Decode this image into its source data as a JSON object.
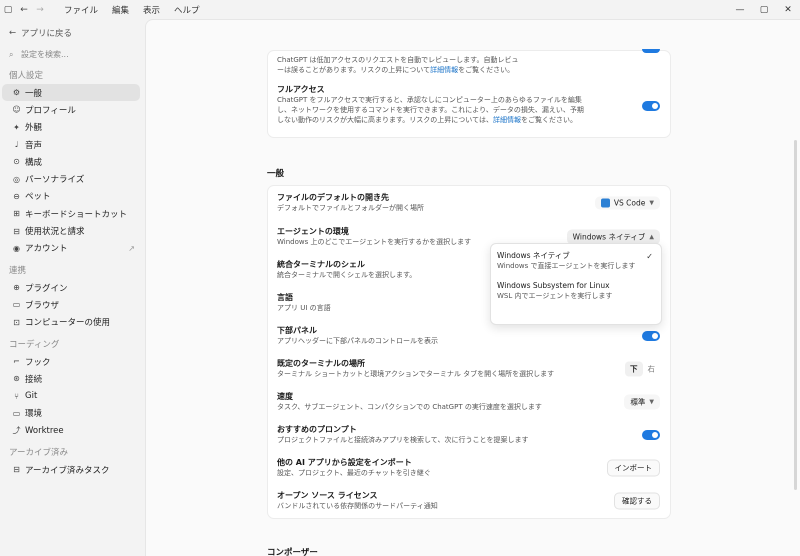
{
  "titlebar": {
    "menu": [
      "ファイル",
      "編集",
      "表示",
      "ヘルプ"
    ]
  },
  "sidebar": {
    "back_label": "アプリに戻る",
    "search_placeholder": "設定を検索...",
    "sections": [
      {
        "label": "個人設定",
        "items": [
          {
            "label": "一般",
            "icon": "gear-icon",
            "active": true
          },
          {
            "label": "プロフィール",
            "icon": "profile-icon"
          },
          {
            "label": "外観",
            "icon": "appearance-icon"
          },
          {
            "label": "音声",
            "icon": "microphone-icon"
          },
          {
            "label": "構成",
            "icon": "config-icon"
          },
          {
            "label": "パーソナライズ",
            "icon": "personalize-icon"
          },
          {
            "label": "ペット",
            "icon": "pet-icon"
          },
          {
            "label": "キーボードショートカット",
            "icon": "keyboard-icon"
          },
          {
            "label": "使用状況と請求",
            "icon": "usage-icon"
          },
          {
            "label": "アカウント",
            "icon": "account-icon",
            "external": true
          }
        ]
      },
      {
        "label": "連携",
        "items": [
          {
            "label": "プラグイン",
            "icon": "plugin-icon"
          },
          {
            "label": "ブラウザ",
            "icon": "browser-icon"
          },
          {
            "label": "コンピューターの使用",
            "icon": "computer-use-icon"
          }
        ]
      },
      {
        "label": "コーディング",
        "items": [
          {
            "label": "フック",
            "icon": "hook-icon"
          },
          {
            "label": "接続",
            "icon": "connection-icon"
          },
          {
            "label": "Git",
            "icon": "git-icon"
          },
          {
            "label": "環境",
            "icon": "environment-icon"
          },
          {
            "label": "Worktree",
            "icon": "worktree-icon"
          }
        ]
      },
      {
        "label": "アーカイブ済み",
        "items": [
          {
            "label": "アーカイブ済みタスク",
            "icon": "archive-icon"
          }
        ]
      }
    ]
  },
  "top_card": {
    "partial_line1": "ChatGPT は低加アクセスのリクエストを自動でレビューします。自動レビュ",
    "partial_line2": "ーは誤ることがあります。リスクの上昇について",
    "partial_link": "詳細情報",
    "partial_end": "をご覧ください。",
    "full_access_title": "フルアクセス",
    "full_access_desc1": "ChatGPT をフルアクセスで実行すると、承認なしにコンピューター上のあらゆるファイルを編集",
    "full_access_desc2": "し、ネットワークを使用するコマンドを実行できます。これにより、データの損失、漏えい、予期",
    "full_access_desc3": "しない動作のリスクが大幅に高まります。リスクの上昇については、",
    "full_access_link": "詳細情報",
    "full_access_end": "をご覧ください。"
  },
  "general": {
    "heading": "一般",
    "rows": [
      {
        "title": "ファイルのデフォルトの開き先",
        "desc": "デフォルトでファイルとフォルダーが開く場所",
        "control": "VS Code"
      },
      {
        "title": "エージェントの環境",
        "desc": "Windows 上のどこでエージェントを実行するかを選択します",
        "control": "Windows ネイティブ"
      },
      {
        "title": "統合ターミナルのシェル",
        "desc": "統合ターミナルで開くシェルを選択します。"
      },
      {
        "title": "言語",
        "desc": "アプリ UI の言語"
      },
      {
        "title": "下部パネル",
        "desc": "アプリヘッダーに下部パネルのコントロールを表示"
      },
      {
        "title": "既定のターミナルの場所",
        "desc": "ターミナル ショートカットと環境アクションでターミナル タブを開く場所を選択します",
        "seg": [
          "下",
          "右"
        ]
      },
      {
        "title": "速度",
        "desc": "タスク、サブエージェント、コンパクションでの ChatGPT の実行速度を選択します",
        "control": "標準"
      },
      {
        "title": "おすすめのプロンプト",
        "desc": "プロジェクトファイルと接続済みアプリを検索して、次に行うことを提案します"
      },
      {
        "title": "他の AI アプリから設定をインポート",
        "desc": "設定、プロジェクト、最近のチャットを引き継ぐ",
        "button": "インポート"
      },
      {
        "title": "オープン ソース ライセンス",
        "desc": "バンドルされている依存関係のサードパーティ通知",
        "button": "確認する"
      }
    ]
  },
  "dropdown": {
    "options": [
      {
        "title": "Windows ネイティブ",
        "desc": "Windows で直接エージェントを実行します",
        "checked": true
      },
      {
        "title": "Windows Subsystem for Linux",
        "desc": "WSL 内でエージェントを実行します"
      }
    ]
  },
  "composer": {
    "heading": "コンポーザー"
  }
}
